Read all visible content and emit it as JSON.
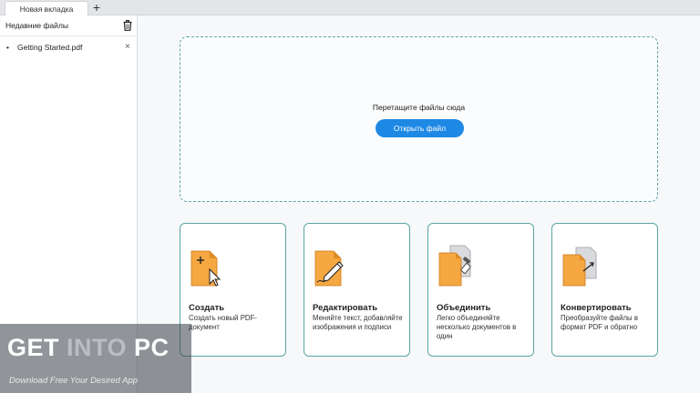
{
  "tabs": [
    {
      "label": "Новая вкладка",
      "active": true
    }
  ],
  "tab_add_glyph": "+",
  "sidebar": {
    "header": "Недавние файлы",
    "items": [
      {
        "name": "Getting Started.pdf",
        "close_glyph": "×"
      }
    ]
  },
  "dropzone": {
    "text": "Перетащите файлы сюда",
    "open_button": "Открыть файл"
  },
  "cards": [
    {
      "title": "Создать",
      "description": "Создать новый PDF-документ",
      "icon": "create-pdf-icon"
    },
    {
      "title": "Редактировать",
      "description": "Меняйте текст, добавляйте изображения и подписи",
      "icon": "edit-pdf-icon"
    },
    {
      "title": "Объединить",
      "description": "Легко объединяйте несколько документов в один",
      "icon": "merge-pdf-icon"
    },
    {
      "title": "Конвертировать",
      "description": "Преобразуйте файлы в формат PDF и обратно",
      "icon": "convert-pdf-icon"
    }
  ],
  "watermark": {
    "word1": "GET ",
    "word2": "INTO ",
    "word3": "PC",
    "subtitle": "Download Free Your Desired App"
  },
  "colors": {
    "accent": "#1e88e5",
    "card_border": "#5aa6a3",
    "doc_orange": "#f5a742"
  }
}
